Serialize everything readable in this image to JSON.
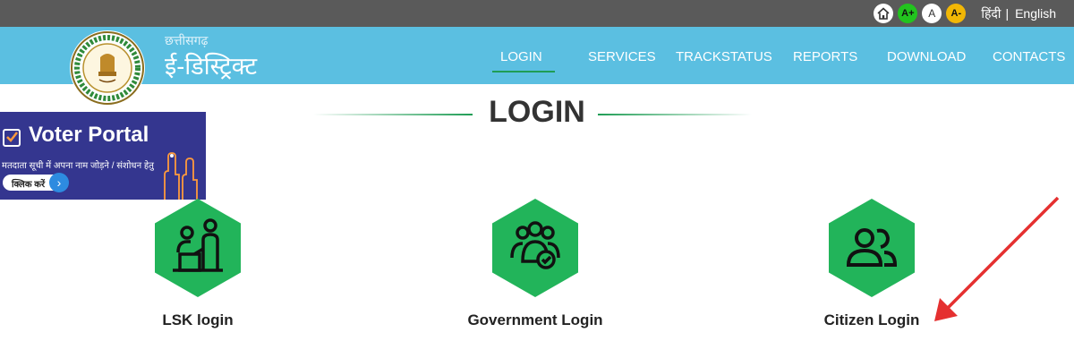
{
  "topbar": {
    "font_increase": "A+",
    "font_reset": "A",
    "font_decrease": "A-",
    "lang_hindi": "हिंदी",
    "lang_separator": "|",
    "lang_english": "English",
    "icons": [
      "home-icon"
    ]
  },
  "header": {
    "brand_small": "छत्तीसगढ़",
    "brand_big": "ई-डिस्ट्रिक्ट",
    "emblem_icon": "state-emblem-icon",
    "nav": [
      {
        "label": "LOGIN",
        "active": true
      },
      {
        "label": "SERVICES"
      },
      {
        "label": "TRACKSTATUS"
      },
      {
        "label": "REPORTS"
      },
      {
        "label": "DOWNLOAD"
      },
      {
        "label": "CONTACTS"
      }
    ]
  },
  "page": {
    "title": "LOGIN"
  },
  "banner": {
    "title": "Voter Portal",
    "subtitle": "मतदाता सूची में अपना नाम जोड़ने / संशोधन हेतु",
    "button": "क्लिक करें"
  },
  "options": [
    {
      "label": "LSK login",
      "icon": "lsk-operator-icon"
    },
    {
      "label": "Government Login",
      "icon": "government-group-icon"
    },
    {
      "label": "Citizen Login",
      "icon": "citizen-users-icon"
    }
  ],
  "colors": {
    "topbar": "#5a5a5a",
    "header": "#5bbfe1",
    "accent_green": "#22b45a",
    "annotation_arrow": "#e53030"
  }
}
